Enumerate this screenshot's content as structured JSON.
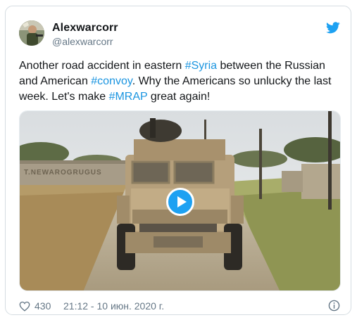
{
  "tweet": {
    "author": {
      "name": "Alexwarcorr",
      "handle": "@alexwarcorr",
      "avatar_icon": "profile-photo"
    },
    "logo_icon": "twitter-bird-icon",
    "text_parts": [
      {
        "text": "Another road accident in eastern ",
        "hashtag": false
      },
      {
        "text": "#Syria",
        "hashtag": true
      },
      {
        "text": " between the Russian and American ",
        "hashtag": false
      },
      {
        "text": "#convoy",
        "hashtag": true
      },
      {
        "text": ".  Why the Americans so unlucky the last week. Let's make ",
        "hashtag": false
      },
      {
        "text": "#MRAP",
        "hashtag": true
      },
      {
        "text": " great again!",
        "hashtag": false
      }
    ],
    "media": {
      "type": "video",
      "play_icon": "play-icon",
      "vehicle_plate_text": "T.NEWAROGRUGUS"
    },
    "footer": {
      "like_count": "430",
      "timestamp": "21:12 - 10 июн. 2020 г.",
      "heart_icon": "heart-icon",
      "info_icon": "info-icon"
    }
  },
  "colors": {
    "hashtag": "#1b95e0",
    "brand": "#1da1f2",
    "text_primary": "#14171a",
    "text_secondary": "#657786",
    "border": "#d5dce1"
  }
}
